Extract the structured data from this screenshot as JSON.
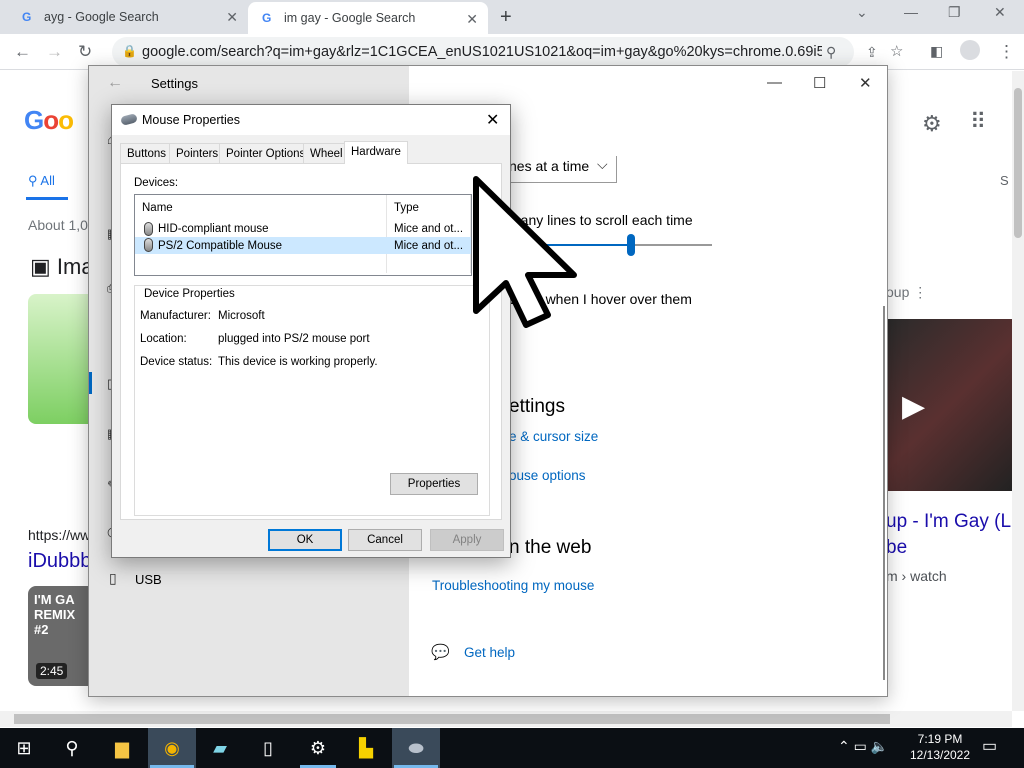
{
  "browser": {
    "tabs": [
      {
        "title": "ayg - Google Search",
        "active": false
      },
      {
        "title": "im gay - Google Search",
        "active": true
      }
    ],
    "url": "google.com/search?q=im+gay&rlz=1C1GCEA_enUS1021US1021&oq=im+gay&go%20kys=chrome.0.69i59..."
  },
  "google": {
    "tab_all": "All",
    "about": "About 1,0",
    "images_heading": "Ima",
    "result_url": "https://ww",
    "result_title": "iDubbb",
    "thumb_text": "I'M GA REMIX #2",
    "duration": "2:45",
    "side_s": "S",
    "video_group": "oup",
    "video_title_1": "up - I'm Gay (L",
    "video_title_2": "be",
    "video_url": "m › watch"
  },
  "settings": {
    "title": "Settings",
    "lines_dropdown": "nes at a time",
    "scroll_lines_label": "many lines to scroll each time",
    "hover_label": "dows when I hover over them",
    "related_heading": "ettings",
    "link_cursor_size": "e & cursor size",
    "link_mouse_options": "ouse options",
    "web_heading": "n the web",
    "link_troubleshoot": "Troubleshooting my mouse",
    "link_help": "Get help",
    "sidebar_usb": "USB",
    "scroll_lines_fraction": 0.6
  },
  "mouse_properties": {
    "title": "Mouse Properties",
    "tabs": [
      "Buttons",
      "Pointers",
      "Pointer Options",
      "Wheel",
      "Hardware"
    ],
    "active_tab": "Hardware",
    "devices_label": "Devices:",
    "columns": [
      "Name",
      "Type"
    ],
    "devices": [
      {
        "name": "HID-compliant mouse",
        "type": "Mice and ot..."
      },
      {
        "name": "PS/2 Compatible Mouse",
        "type": "Mice and ot..."
      }
    ],
    "device_properties_label": "Device Properties",
    "manufacturer_key": "Manufacturer:",
    "manufacturer_val": "Microsoft",
    "location_key": "Location:",
    "location_val": "plugged into PS/2 mouse port",
    "status_key": "Device status:",
    "status_val": "This device is working properly.",
    "properties_button": "Properties",
    "ok_button": "OK",
    "cancel_button": "Cancel",
    "apply_button": "Apply"
  },
  "taskbar": {
    "time": "7:19 PM",
    "date": "12/13/2022"
  }
}
